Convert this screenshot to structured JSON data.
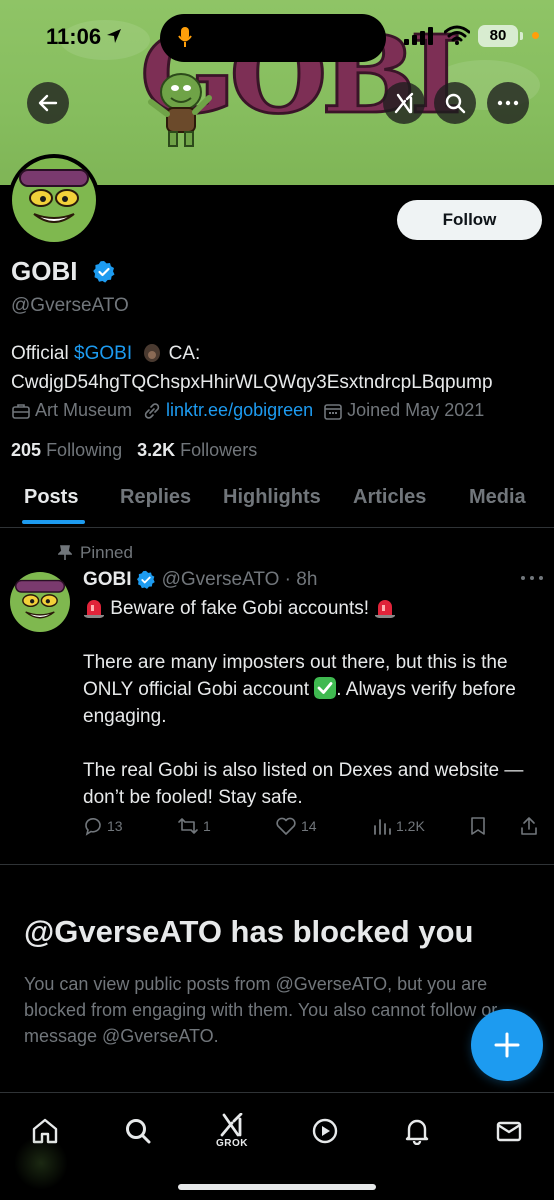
{
  "status_bar": {
    "time": "11:06",
    "battery": "80"
  },
  "banner": {
    "logo_text": "GOBI"
  },
  "profile": {
    "follow_label": "Follow",
    "name": "GOBI",
    "handle": "@GverseATO",
    "bio_prefix": "Official ",
    "bio_cashtag": "$GOBI",
    "bio_ca": " CA:",
    "bio_contract": "CwdjgD54hgTQChspxHhirWLQWqy3EsxtndrcpLBqpump",
    "category": "Art Museum",
    "website": "linktr.ee/gobigreen",
    "joined": "Joined May 2021",
    "following_count": "205",
    "following_label": "Following",
    "followers_count": "3.2K",
    "followers_label": "Followers"
  },
  "tabs": [
    {
      "label": "Posts",
      "active": true
    },
    {
      "label": "Replies"
    },
    {
      "label": "Highlights"
    },
    {
      "label": "Articles"
    },
    {
      "label": "Media"
    }
  ],
  "post": {
    "pinned_label": "Pinned",
    "author": "GOBI",
    "handle_time": "@GverseATO · 8h",
    "line1": " Beware of fake Gobi accounts! ",
    "para2a": "There are many imposters out there, but this is the ONLY official Gobi account ",
    "para2b": ". Always verify before engaging.",
    "para3": "The real Gobi is also listed on Dexes and website —don’t be fooled! Stay safe.",
    "replies": "13",
    "reposts": "1",
    "likes": "14",
    "views": "1.2K"
  },
  "blocked": {
    "title": "@GverseATO has blocked you",
    "text": "You can view public posts from @GverseATO, but you are blocked from engaging with them. You also cannot follow or message @GverseATO."
  },
  "bottom_nav": {
    "grok_label": "GROK"
  },
  "colors": {
    "accent": "#1d9bf0",
    "banner": "#86bd5e",
    "logo": "#7d2f55"
  }
}
